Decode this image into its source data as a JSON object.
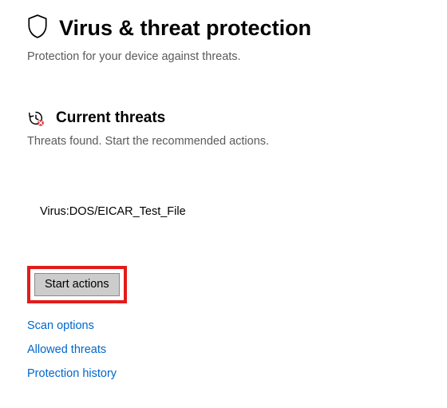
{
  "header": {
    "title": "Virus & threat protection",
    "subtitle": "Protection for your device against threats."
  },
  "current_threats": {
    "title": "Current threats",
    "subtitle": "Threats found. Start the recommended actions.",
    "threat_name": "Virus:DOS/EICAR_Test_File"
  },
  "actions": {
    "start_button": "Start actions"
  },
  "links": {
    "scan_options": "Scan options",
    "allowed_threats": "Allowed threats",
    "protection_history": "Protection history"
  }
}
